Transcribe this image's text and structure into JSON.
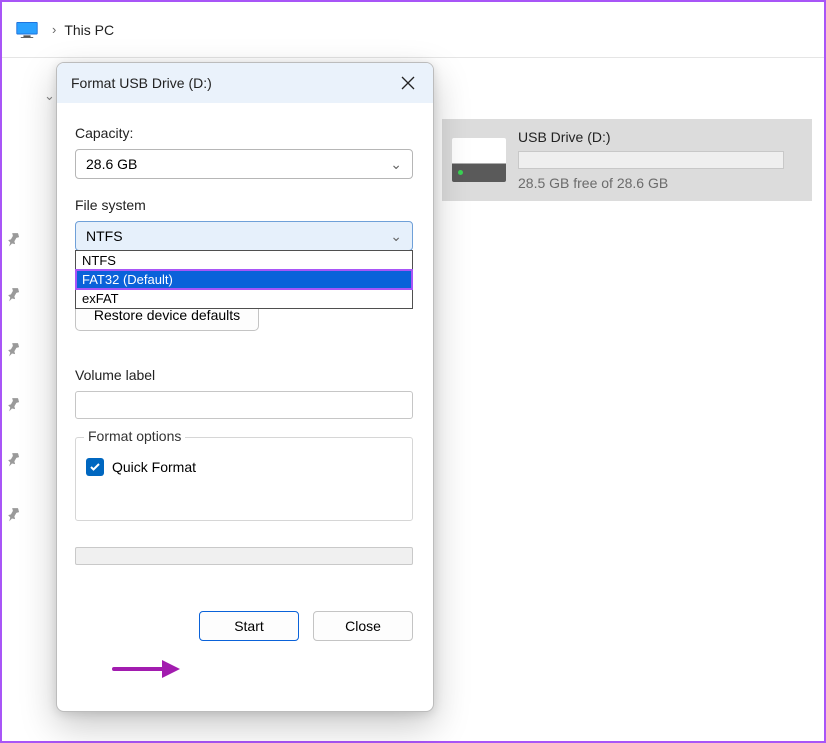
{
  "breadcrumb": {
    "location": "This PC"
  },
  "dialog": {
    "title": "Format USB Drive (D:)",
    "capacity_label": "Capacity:",
    "capacity_value": "28.6 GB",
    "filesystem_label": "File system",
    "filesystem_selected": "NTFS",
    "filesystem_options": {
      "ntfs": "NTFS",
      "fat32": "FAT32 (Default)",
      "exfat": "exFAT"
    },
    "restore_defaults": "Restore device defaults",
    "volume_label_caption": "Volume label",
    "volume_label_value": "",
    "format_options_caption": "Format options",
    "quick_format_label": "Quick Format",
    "quick_format_checked": true,
    "start_button": "Start",
    "close_button": "Close"
  },
  "drive_tile": {
    "name": "USB Drive (D:)",
    "free_text": "28.5 GB free of 28.6 GB"
  }
}
